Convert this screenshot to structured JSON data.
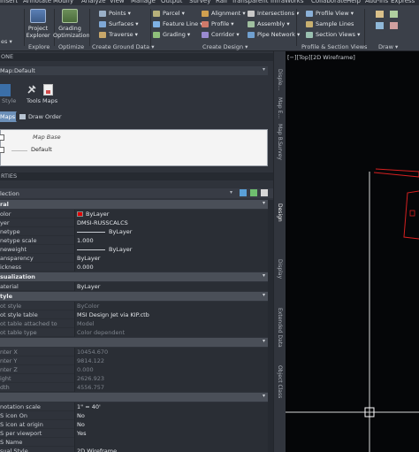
{
  "menu": [
    "Insert",
    "Annotate",
    "Modify",
    "Analyze",
    "View",
    "Manage",
    "Output",
    "Survey",
    "Rail",
    "Transparent",
    "InfraWorks",
    "Collaborate",
    "Help",
    "Add-ins",
    "Express"
  ],
  "ribbon": {
    "partial_left": "es ▾",
    "explore": {
      "btn_project_explorer": [
        "Project",
        "Explorer"
      ],
      "title": "Explore"
    },
    "optimize": {
      "btn_grading_optimization": [
        "Grading",
        "Optimization"
      ],
      "title": "Optimize"
    },
    "ground": {
      "items": [
        "Points ▾",
        "Surfaces ▾",
        "Traverse ▾"
      ],
      "title": "Create Ground Data ▾"
    },
    "design": {
      "col1": [
        "Parcel ▾",
        "Feature Line ▾",
        "Grading ▾"
      ],
      "col2": [
        "Alignment ▾",
        "Profile ▾",
        "Corridor ▾"
      ],
      "col3": [
        "Intersections ▾",
        "Assembly ▾",
        "Pipe Network ▾"
      ],
      "title": "Create Design ▾"
    },
    "profile_section": {
      "items": [
        "Profile View ▾",
        "Sample Lines",
        "Section Views ▾"
      ],
      "title": "Profile & Section Views"
    },
    "draw": {
      "title": "Draw ▾"
    }
  },
  "left_panel": {
    "header1": "ONE",
    "map_label": "Map:",
    "map_value": "Default",
    "toolbar": {
      "style_label": "Style",
      "tools_label": "Tools",
      "maps_label": "Maps"
    },
    "tabs": {
      "maps_tab": "Maps",
      "draw_order_tab": "Draw Order"
    },
    "map_base": "Map Base",
    "default_row": "Default",
    "header2": "RTIES",
    "selection_label": "lection",
    "categories": [
      {
        "title": "ral",
        "rows": [
          {
            "label": "olor",
            "value": "ByLayer",
            "swatch": "#e00000"
          },
          {
            "label": "yer",
            "value": "DMSI-RUSSCALCS"
          },
          {
            "label": "netype",
            "value": "ByLayer",
            "line": true
          },
          {
            "label": "netype scale",
            "value": "1.000"
          },
          {
            "label": "neweight",
            "value": "ByLayer",
            "line": true
          },
          {
            "label": "ansparency",
            "value": "ByLayer"
          },
          {
            "label": "ickness",
            "value": "0.000"
          }
        ]
      },
      {
        "title": "sualization",
        "rows": [
          {
            "label": "aterial",
            "value": "ByLayer"
          }
        ]
      },
      {
        "title": "tyle",
        "rows": [
          {
            "label": "ot style",
            "value": "ByColor",
            "dim": true
          },
          {
            "label": "ot style table",
            "value": "MSI Design Jet via KIP.ctb"
          },
          {
            "label": "ot table attached to",
            "value": "Model",
            "dim": true
          },
          {
            "label": "ot table type",
            "value": "Color dependent",
            "dim": true
          }
        ]
      },
      {
        "title": "",
        "rows": [
          {
            "label": "nter X",
            "value": "10454.670",
            "dim": true
          },
          {
            "label": "nter Y",
            "value": "9814.122",
            "dim": true
          },
          {
            "label": "nter Z",
            "value": "0.000",
            "dim": true
          },
          {
            "label": "ight",
            "value": "2626.923",
            "dim": true
          },
          {
            "label": "dth",
            "value": "4556.757",
            "dim": true
          }
        ]
      },
      {
        "title": "",
        "rows": [
          {
            "label": "notation scale",
            "value": "1\" = 40'"
          },
          {
            "label": "S icon On",
            "value": "No"
          },
          {
            "label": "S icon at origin",
            "value": "No"
          },
          {
            "label": "S per viewport",
            "value": "Yes"
          },
          {
            "label": "S Name",
            "value": ""
          },
          {
            "label": "sual Style",
            "value": "2D Wireframe"
          }
        ]
      }
    ]
  },
  "vtabs_top": [
    "Map E...",
    "Survey",
    "Disple..."
  ],
  "vtabs_main": [
    "Design",
    "Display",
    "Extended Data",
    "Object Class"
  ],
  "viewport": {
    "label": "[−][Top][2D Wireframe]"
  },
  "colors": {
    "accent_red": "#e00000",
    "ribbon_bg": "#3b4049",
    "panel_bg": "#2f333b",
    "viewport_bg": "#050608"
  }
}
